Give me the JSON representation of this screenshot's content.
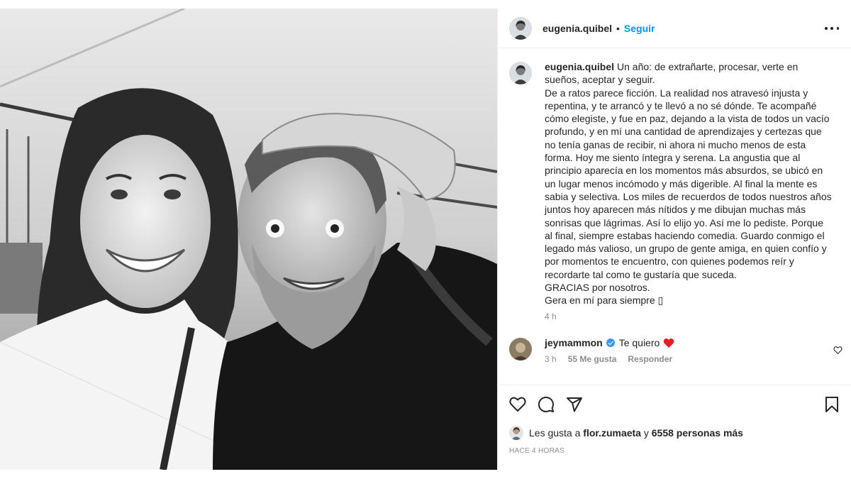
{
  "post": {
    "photo_icon": "selfie-photo",
    "header": {
      "username": "eugenia.quibel",
      "separator": "•",
      "follow_label": "Seguir",
      "more_icon": "more-horizontal-icon"
    },
    "caption": {
      "username": "eugenia.quibel",
      "text": "Un año: de extrañarte, procesar, verte en sueños, aceptar y seguir.",
      "paragraph": "De a ratos parece ficción. La realidad nos atravesó injusta y repentina, y te arrancó y te llevó a no sé dónde. Te acompañé cómo elegiste, y fue en paz, dejando a la vista de todos un vacío profundo, y en mí una cantidad de aprendizajes y certezas que no tenía ganas de recibir, ni ahora ni mucho menos de esta forma. Hoy me siento íntegra y serena. La angustia que al principio aparecía en los momentos más absurdos, se ubicó en un lugar menos incómodo y más digerible. Al final la mente es sabia y selectiva. Los miles de recuerdos de todos nuestros años juntos hoy aparecen más nítidos y me dibujan muchas más sonrisas que lágrimas. Así lo elijo yo. Así me lo pediste. Porque al final, siempre estabas haciendo comedia. Guardo conmigo el legado más valioso, un grupo de gente amiga, en quien confío y por momentos te encuentro, con quienes podemos reír y recordarte tal como te gustaría que suceda.",
      "thanks": "GRACIAS por nosotros.",
      "closing": "Gera en mí para siempre ▯",
      "time": "4 h"
    },
    "comment": {
      "username": "jeymammon",
      "verified_icon": "verified-badge-icon",
      "text": "Te quiero",
      "emoji_icon": "red-heart-icon",
      "time": "3 h",
      "likes": "55 Me gusta",
      "reply_label": "Responder"
    },
    "actions": {
      "like_icon": "heart-icon",
      "comment_icon": "comment-icon",
      "share_icon": "share-icon",
      "save_icon": "bookmark-icon"
    },
    "likes_summary": {
      "prefix": "Les gusta a",
      "user": "flor.zumaeta",
      "middle": "y",
      "others": "6558 personas más"
    },
    "posted_ago": "HACE 4 HORAS"
  },
  "colors": {
    "accent": "#0095f6",
    "text": "#262626",
    "secondary": "#8e8e8e",
    "heart": "#ed1c24",
    "verified": "#3897f0"
  }
}
